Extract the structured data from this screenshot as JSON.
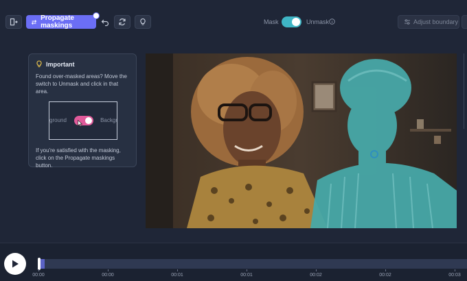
{
  "toolbar": {
    "propagate_label": "Propagate maskings",
    "mask_label": "Mask",
    "unmask_label": "Unmask",
    "mask_mode": "mask",
    "adjust_label": "Adjust boundary",
    "icons": [
      "exit-panel-icon",
      "propagate-icon",
      "undo-icon",
      "refresh-icon",
      "lightbulb-icon",
      "info-icon",
      "sliders-icon"
    ]
  },
  "tip": {
    "title": "Important",
    "text1": "Found over-masked areas? Move the switch to Unmask and click in that area.",
    "demo_left": "ground",
    "demo_right": "Backgr",
    "text2": "If you're satisfied with the masking, click on the Propagate maskings button."
  },
  "timeline": {
    "progress": 0.01,
    "ticks": [
      "00:00",
      "00:00",
      "00:01",
      "00:01",
      "00:02",
      "00:02",
      "00:03"
    ]
  },
  "colors": {
    "accent": "#6b6ef5",
    "mask_overlay": "#3fb5c5",
    "toggle_demo": "#e05a9a",
    "tip_title_icon": "#f2c94c"
  }
}
